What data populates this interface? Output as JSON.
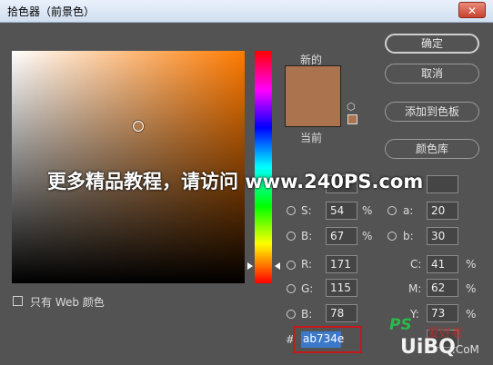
{
  "window": {
    "title": "拾色器（前景色）",
    "close_label": "✕"
  },
  "swatches": {
    "new_label": "新的",
    "current_label": "当前",
    "new_color": "#ab734e",
    "current_color": "#ab734e"
  },
  "buttons": {
    "ok": "确定",
    "cancel": "取消",
    "add_to_swatches": "添加到色板",
    "color_libraries": "颜色库"
  },
  "hsb": {
    "s_label": "S:",
    "s_value": "54",
    "s_unit": "%",
    "b_label": "B:",
    "b_value": "67",
    "b_unit": "%"
  },
  "lab": {
    "a_label": "a:",
    "a_value": "20",
    "b_label": "b:",
    "b_value": "30"
  },
  "rgb": {
    "r_label": "R:",
    "r_value": "171",
    "g_label": "G:",
    "g_value": "115",
    "b_label": "B:",
    "b_value": "78"
  },
  "cmyk": {
    "c_label": "C:",
    "c_value": "41",
    "c_unit": "%",
    "m_label": "M:",
    "m_value": "62",
    "m_unit": "%",
    "y_label": "Y:",
    "y_value": "73",
    "y_unit": "%"
  },
  "hex": {
    "label": "#",
    "value": "ab734e"
  },
  "web_only": {
    "label": "只有 Web 颜色"
  },
  "overlay": {
    "watermark": "更多精品教程，请访问 www.240PS.com",
    "logo_ps": "PS",
    "logo_cn": "爱好者",
    "logo_uibq": "UiBQ",
    "logo_com": ".CoM"
  }
}
